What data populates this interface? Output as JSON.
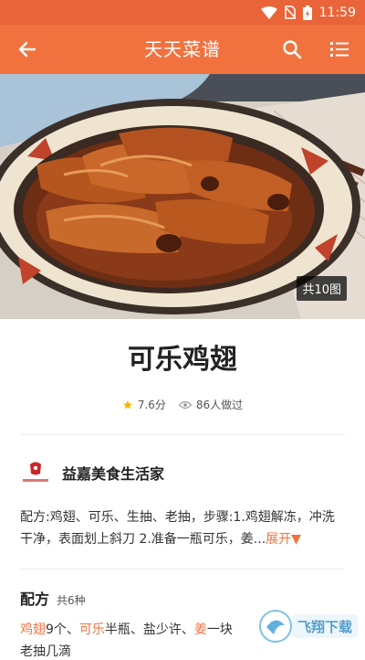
{
  "status_bar": {
    "time": "11:59"
  },
  "app_bar": {
    "title": "天天菜谱"
  },
  "hero": {
    "photo_count": "共10图"
  },
  "recipe": {
    "name": "可乐鸡翅",
    "rating": "7.6分",
    "made_count": "86人做过"
  },
  "author": {
    "name": "益嘉美食生活家",
    "logo_text": "益嘉美食生活家"
  },
  "description": {
    "text": "配方:鸡翅、可乐、生抽、老抽，步骤:1.鸡翅解冻，冲洗干净，表面划上斜刀 2.准备一瓶可乐，姜...",
    "expand": "展开▼"
  },
  "ingredients": {
    "heading": "配方",
    "count": "共6种",
    "items": [
      {
        "name": "鸡翅",
        "amount": "9个"
      },
      {
        "name": "可乐",
        "amount": "半瓶"
      },
      {
        "name": "盐",
        "amount": "少许"
      },
      {
        "name": "姜",
        "amount": "一块"
      }
    ],
    "partial_next": "老抽",
    "partial_next_amount": "几滴"
  },
  "watermark": "飞翔下载",
  "colors": {
    "primary": "#f2723f",
    "status": "#e96438"
  }
}
